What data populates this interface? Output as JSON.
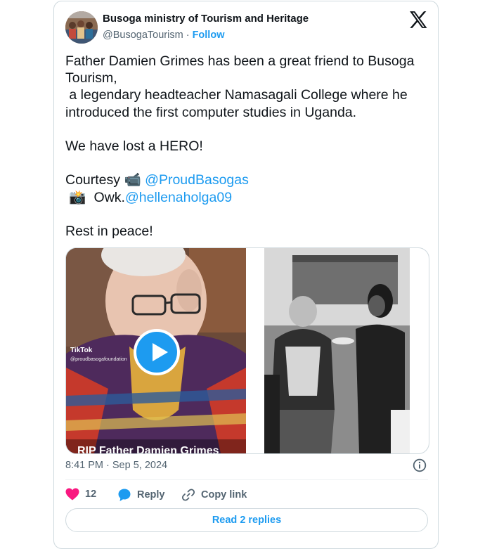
{
  "author": {
    "name": "Busoga ministry of Tourism and Heritage",
    "handle": "@BusogaTourism",
    "separator": "·",
    "follow_label": "Follow"
  },
  "tweet": {
    "lines": [
      {
        "text": "Father Damien Grimes has been a great friend to Busoga"
      },
      {
        "text": "Tourism,"
      },
      {
        "text": " a legendary headteacher Namasagali College where he"
      },
      {
        "text": "introduced the first computer studies in Uganda."
      },
      {
        "text": ""
      },
      {
        "text": "We have lost a HERO!"
      },
      {
        "text": ""
      },
      {
        "prefix": "Courtesy 📹 ",
        "mention": "@ProudBasogas"
      },
      {
        "prefix": " 📸  Owk.",
        "mention": "@hellenaholga09"
      },
      {
        "text": ""
      },
      {
        "text": "Rest in peace!"
      }
    ]
  },
  "media": {
    "tiktok_label": "TikTok",
    "tiktok_handle": "@proudbasogafoundation",
    "caption": "RIP Father Damien Grimes"
  },
  "meta": {
    "timestamp": "8:41 PM · Sep 5, 2024"
  },
  "actions": {
    "like_count": "12",
    "reply_label": "Reply",
    "copy_label": "Copy link"
  },
  "footer": {
    "read_replies_label": "Read 2 replies"
  },
  "colors": {
    "accent": "#1d9bf0",
    "like": "#f91880",
    "muted": "#536471"
  }
}
